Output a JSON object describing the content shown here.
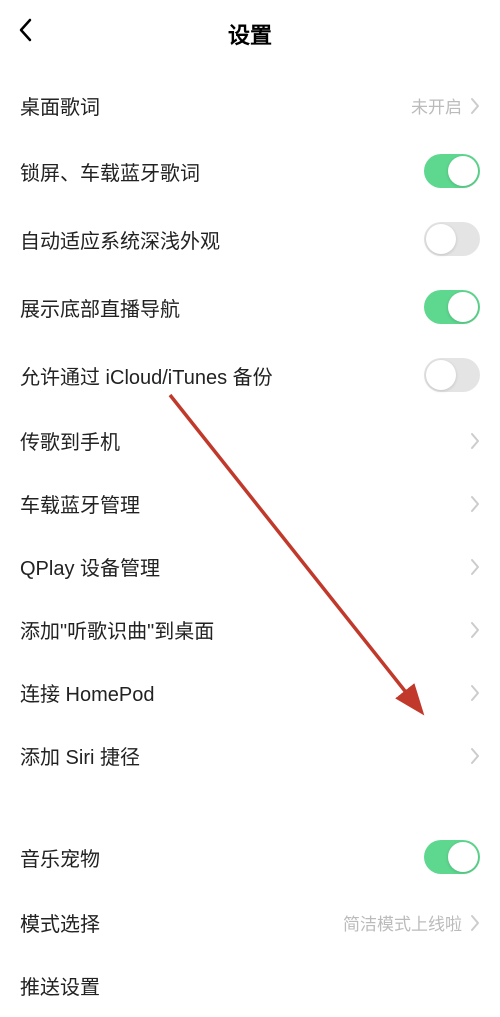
{
  "header": {
    "title": "设置"
  },
  "rows": [
    {
      "label": "桌面歌词",
      "type": "nav",
      "value": "未开启"
    },
    {
      "label": "锁屏、车载蓝牙歌词",
      "type": "toggle",
      "on": true
    },
    {
      "label": "自动适应系统深浅外观",
      "type": "toggle",
      "on": false
    },
    {
      "label": "展示底部直播导航",
      "type": "toggle",
      "on": true
    },
    {
      "label": "允许通过 iCloud/iTunes 备份",
      "type": "toggle",
      "on": false
    },
    {
      "label": "传歌到手机",
      "type": "nav"
    },
    {
      "label": "车载蓝牙管理",
      "type": "nav"
    },
    {
      "label": "QPlay 设备管理",
      "type": "nav"
    },
    {
      "label": "添加\"听歌识曲\"到桌面",
      "type": "nav"
    },
    {
      "label": "连接 HomePod",
      "type": "nav"
    },
    {
      "label": "添加 Siri 捷径",
      "type": "nav"
    }
  ],
  "rows2": [
    {
      "label": "音乐宠物",
      "type": "toggle",
      "on": true
    },
    {
      "label": "模式选择",
      "type": "nav",
      "value": "简洁模式上线啦"
    },
    {
      "label": "推送设置",
      "type": "nav-partial"
    }
  ]
}
